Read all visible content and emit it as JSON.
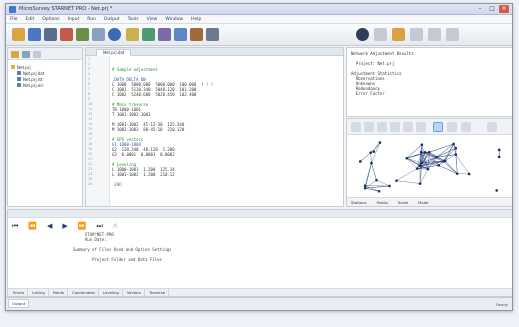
{
  "window": {
    "title": "MicroSurvey STARNET PRO - Net.prj *"
  },
  "menu": [
    "File",
    "Edit",
    "Options",
    "Input",
    "Run",
    "Output",
    "Tools",
    "View",
    "Window",
    "Help"
  ],
  "filetree": {
    "root": "Net.prj",
    "items": [
      "Net.prj.dat",
      "Net.prj.lst",
      "Net.prj.err"
    ]
  },
  "editor": {
    "tab": "Net.prj.dat",
    "lines": [
      {
        "t": "",
        "c": ""
      },
      {
        "t": "",
        "c": ""
      },
      {
        "t": "# Sample adjustment",
        "c": "c-green"
      },
      {
        "t": "",
        "c": ""
      },
      {
        "t": ".DATA DELTA ON",
        "c": "c-blue"
      },
      {
        "t": "C 1000  5000.000  5000.000  100.000  ! ! !",
        "c": ""
      },
      {
        "t": "C 1001  5120.340  5040.120  101.200",
        "c": ""
      },
      {
        "t": "C 1002  5240.680  5020.450  102.400",
        "c": ""
      },
      {
        "t": "",
        "c": ""
      },
      {
        "t": "# Main traverse",
        "c": "c-green"
      },
      {
        "t": "TB 1000-1001",
        "c": ""
      },
      {
        "t": "T 1001-1002-1003",
        "c": ""
      },
      {
        "t": "",
        "c": ""
      },
      {
        "t": "M 1001-1002  45-12-30  125.340",
        "c": ""
      },
      {
        "t": "M 1002-1003  88-45-10  210.120",
        "c": ""
      },
      {
        "t": "",
        "c": ""
      },
      {
        "t": "# GPS vectors",
        "c": "c-green"
      },
      {
        "t": "G1 1000-1004",
        "c": "c-blue"
      },
      {
        "t": "G2  120.340  40.120  1.200",
        "c": ""
      },
      {
        "t": "G3  0.0001  0.0001  0.0002",
        "c": ""
      },
      {
        "t": "",
        "c": ""
      },
      {
        "t": "# Leveling",
        "c": "c-green"
      },
      {
        "t": "L 1000-1001  1.200  125.34",
        "c": ""
      },
      {
        "t": "L 1001-1002  1.200  210.12",
        "c": ""
      },
      {
        "t": "",
        "c": ""
      },
      {
        "t": ".END",
        "c": "c-gray"
      }
    ]
  },
  "results": {
    "lines": [
      "Network Adjustment Results",
      "",
      "  Project: Net.prj",
      "",
      "Adjustment Statistics",
      "  Observations",
      "  Unknowns",
      "  Redundancy",
      "  Error Factor"
    ]
  },
  "network": {
    "status": [
      "Stations",
      "Points",
      "Scale",
      "Mode"
    ]
  },
  "console": {
    "lines": [
      "       STAR*NET-PRO",
      "       Run Date:",
      "",
      "  Summary of Files Used and Option Settings",
      "",
      "          Project Folder and Data Files",
      ""
    ]
  },
  "bottom_tabs": [
    "Errors",
    "Listing",
    "Points",
    "Coordinates",
    "Leveling",
    "Vectors",
    "Traverse"
  ],
  "statusbar": {
    "tab": "Output",
    "right": "Ready"
  }
}
